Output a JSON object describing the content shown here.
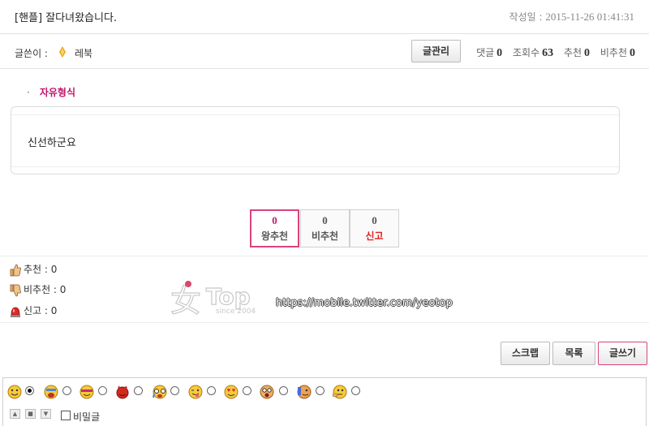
{
  "post": {
    "title": "[핸플] 잘다녀왔습니다.",
    "date_label": "작성일 : ",
    "date_value": "2015-11-26 01:41:31",
    "author_label": "글쓴이 :",
    "author_name": "레북",
    "manage_button": "글관리",
    "stats": {
      "comments_label": "댓글",
      "comments": "0",
      "views_label": "조회수",
      "views": "63",
      "recommend_label": "추천",
      "recommend": "0",
      "notrecommend_label": "비추천",
      "notrecommend": "0"
    },
    "category_bullet": "·",
    "category": "자유형식",
    "body": "신선하군요"
  },
  "votes": [
    {
      "count": "0",
      "label": "왕추천"
    },
    {
      "count": "0",
      "label": "비추천"
    },
    {
      "count": "0",
      "label": "신고"
    }
  ],
  "tally": {
    "recommend": "추천 : 0",
    "notrecommend": "비추천 : 0",
    "report": "신고 : 0"
  },
  "watermark": {
    "logo": "Top",
    "since": "since 2004",
    "url": "https://mobile.twitter.com/yeotop"
  },
  "actions": {
    "scrap": "스크랩",
    "list": "목록",
    "write": "글쓰기"
  },
  "comment_form": {
    "secret_label": "비밀글",
    "emoticon_icons": [
      "smile-emoticon",
      "angry-shout-emoticon",
      "grin-emoticon",
      "devil-emoticon",
      "cry-emoticon",
      "tongue-emoticon",
      "love-emoticon",
      "surprised-emoticon",
      "dizzy-emoticon",
      "think-emoticon"
    ]
  },
  "colors": {
    "accent_pink": "#c2176f",
    "report_red": "#e02020",
    "border_gray": "#e2e2e2"
  }
}
